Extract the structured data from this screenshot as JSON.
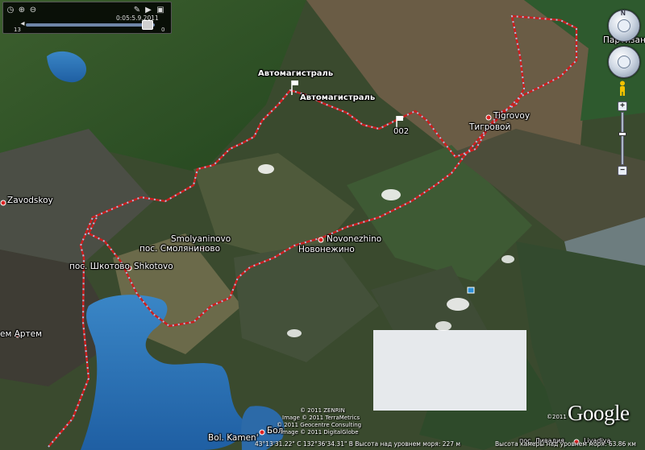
{
  "timeline": {
    "date_time": "0:05:5.9.2011",
    "left_value": "13",
    "right_value": "0"
  },
  "labels": {
    "highway_1": "Автомагистраль",
    "highway_2": "Автомагистраль",
    "waypoint": "002",
    "tigrovoy_en": "Tigrovoy",
    "tigrovoy_ru": "Тигровой",
    "zavodskoy": "Zavodskoy",
    "smolyaninovo_en": "Smolyaninovo",
    "smolyaninovo_ru": "пос. Смоляниново",
    "novonezhino_en": "Novonezhino",
    "novonezhino_ru": "Новонежино",
    "shkotovo_ru": "пос. Шкотово",
    "shkotovo_en": "Shkotovo",
    "artem": "ем Артем",
    "partizansk": "Партизанс",
    "bol_kamen_en": "Bol. Kamen'",
    "bol_kamen_ru": "Бол",
    "livadiya": "пос. Ливадия",
    "livadiya_en": "Livadiya",
    "copyright_2011_1": "©2011"
  },
  "copyright": {
    "line1": "© 2011 ZENRIN",
    "line2": "Image © 2011 TerraMetrics",
    "line3": "© 2011 Geocentre Consulting",
    "line4": "Image © 2011 DigitalGlobe"
  },
  "logo": "Google",
  "status": {
    "coordinates": "43°13'31.22\" С  132°36'34.31\" В  Высота над уровнем моря:   227 м",
    "eye_altitude": "Высота камеры над уровнем моря:    63.86 км"
  },
  "icons": {
    "look": "compass-ring-icon",
    "move": "move-ring-icon",
    "pegman": "pegman-icon",
    "flag": "flag-icon",
    "place": "place-dot-icon",
    "photo": "photo-marker-icon"
  },
  "colors": {
    "track": "#cc1f1f",
    "track_points": "#9fd3f5",
    "water": "#2f6fb0",
    "forest": "#2f5a2a",
    "land": "#5d5b3f"
  }
}
